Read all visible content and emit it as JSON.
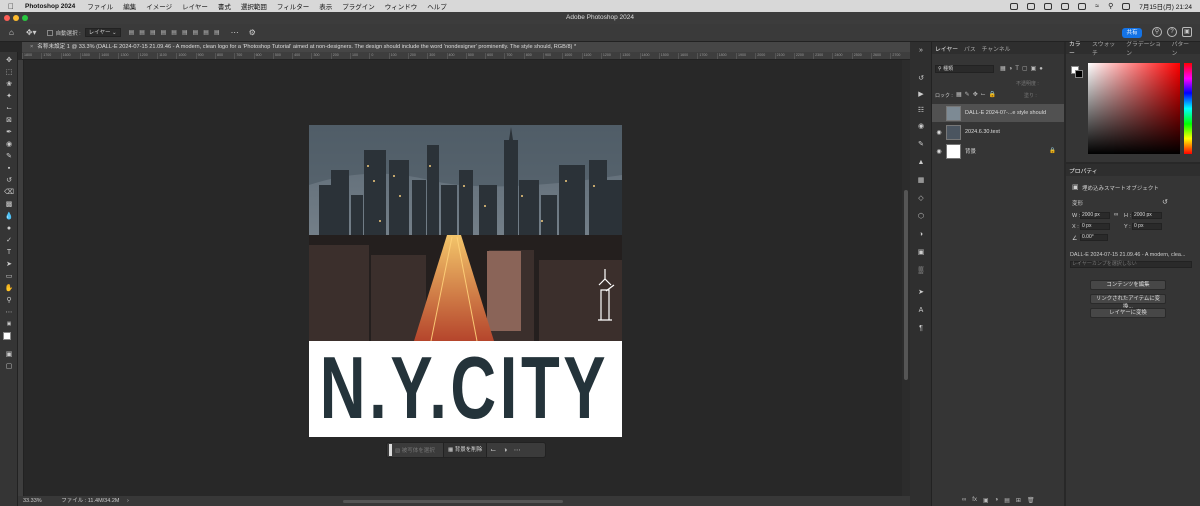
{
  "menubar": {
    "app": "Photoshop 2024",
    "items": [
      "ファイル",
      "編集",
      "イメージ",
      "レイヤー",
      "書式",
      "選択範囲",
      "フィルター",
      "表示",
      "プラグイン",
      "ウィンドウ",
      "ヘルプ"
    ],
    "clock": "7月15日(月) 21:24"
  },
  "window": {
    "title": "Adobe Photoshop 2024"
  },
  "options": {
    "auto_select": "自動選択 :",
    "layer_dropdown": "レイヤー",
    "share": "共有"
  },
  "document": {
    "tab_title": "名称未設定 1 @ 33.3% (DALL-E 2024-07-15 21.09.46 - A modern, clean logo for a 'Photoshop Tutorial' aimed at non-designers. The design should include the word 'nondesigner' prominently. The style should, RGB/8) *",
    "logo_text": "N.Y.CITY"
  },
  "ruler": {
    "ticks": [
      "1800",
      "1700",
      "1600",
      "1500",
      "1400",
      "1300",
      "1200",
      "1100",
      "1000",
      "900",
      "800",
      "700",
      "600",
      "500",
      "400",
      "300",
      "200",
      "100",
      "0",
      "100",
      "200",
      "300",
      "400",
      "500",
      "600",
      "700",
      "800",
      "900",
      "1000",
      "1100",
      "1200",
      "1300",
      "1400",
      "1500",
      "1600",
      "1700",
      "1800",
      "1900",
      "2000",
      "2100",
      "2200",
      "2300",
      "2400",
      "2500",
      "2600",
      "2700",
      "2800",
      "2900",
      "3000",
      "3100",
      "3200",
      "3300",
      "3400",
      "3500",
      "3600",
      "3700"
    ]
  },
  "context_bar": {
    "select_subject": "被写体を選択",
    "remove_bg": "背景を削除"
  },
  "status": {
    "zoom": "33.33%",
    "file": "ファイル : 11.4M/34.2M"
  },
  "layers_panel": {
    "tabs": [
      "レイヤー",
      "パス",
      "チャンネル"
    ],
    "filter": "種類",
    "lock_label": "ロック :",
    "opacity_label": "不透明度 :",
    "fill_label": "塗り :",
    "layers": [
      {
        "name": "DALL-E 2024-07-...e style should"
      },
      {
        "name": "2024.6.30.text"
      },
      {
        "name": "背景"
      }
    ]
  },
  "color_panel": {
    "tabs": [
      "カラー",
      "スウォッチ",
      "グラデーション",
      "パターン"
    ]
  },
  "properties": {
    "title": "プロパティ",
    "type": "埋め込みスマートオブジェクト",
    "transform": "変形",
    "w_label": "W :",
    "w_value": "2000 px",
    "h_label": "H :",
    "h_value": "2000 px",
    "x_label": "X :",
    "x_value": "0 px",
    "y_label": "Y :",
    "y_value": "0 px",
    "angle": "0.00°",
    "linked_name": "DALL-E 2024-07-15 21.09.46 - A modern, clea...",
    "comp": "レイヤーカンプを選択しない",
    "buttons": [
      "コンテンツを編集",
      "リンクされたアイテムに変換...",
      "レイヤーに変換"
    ]
  }
}
